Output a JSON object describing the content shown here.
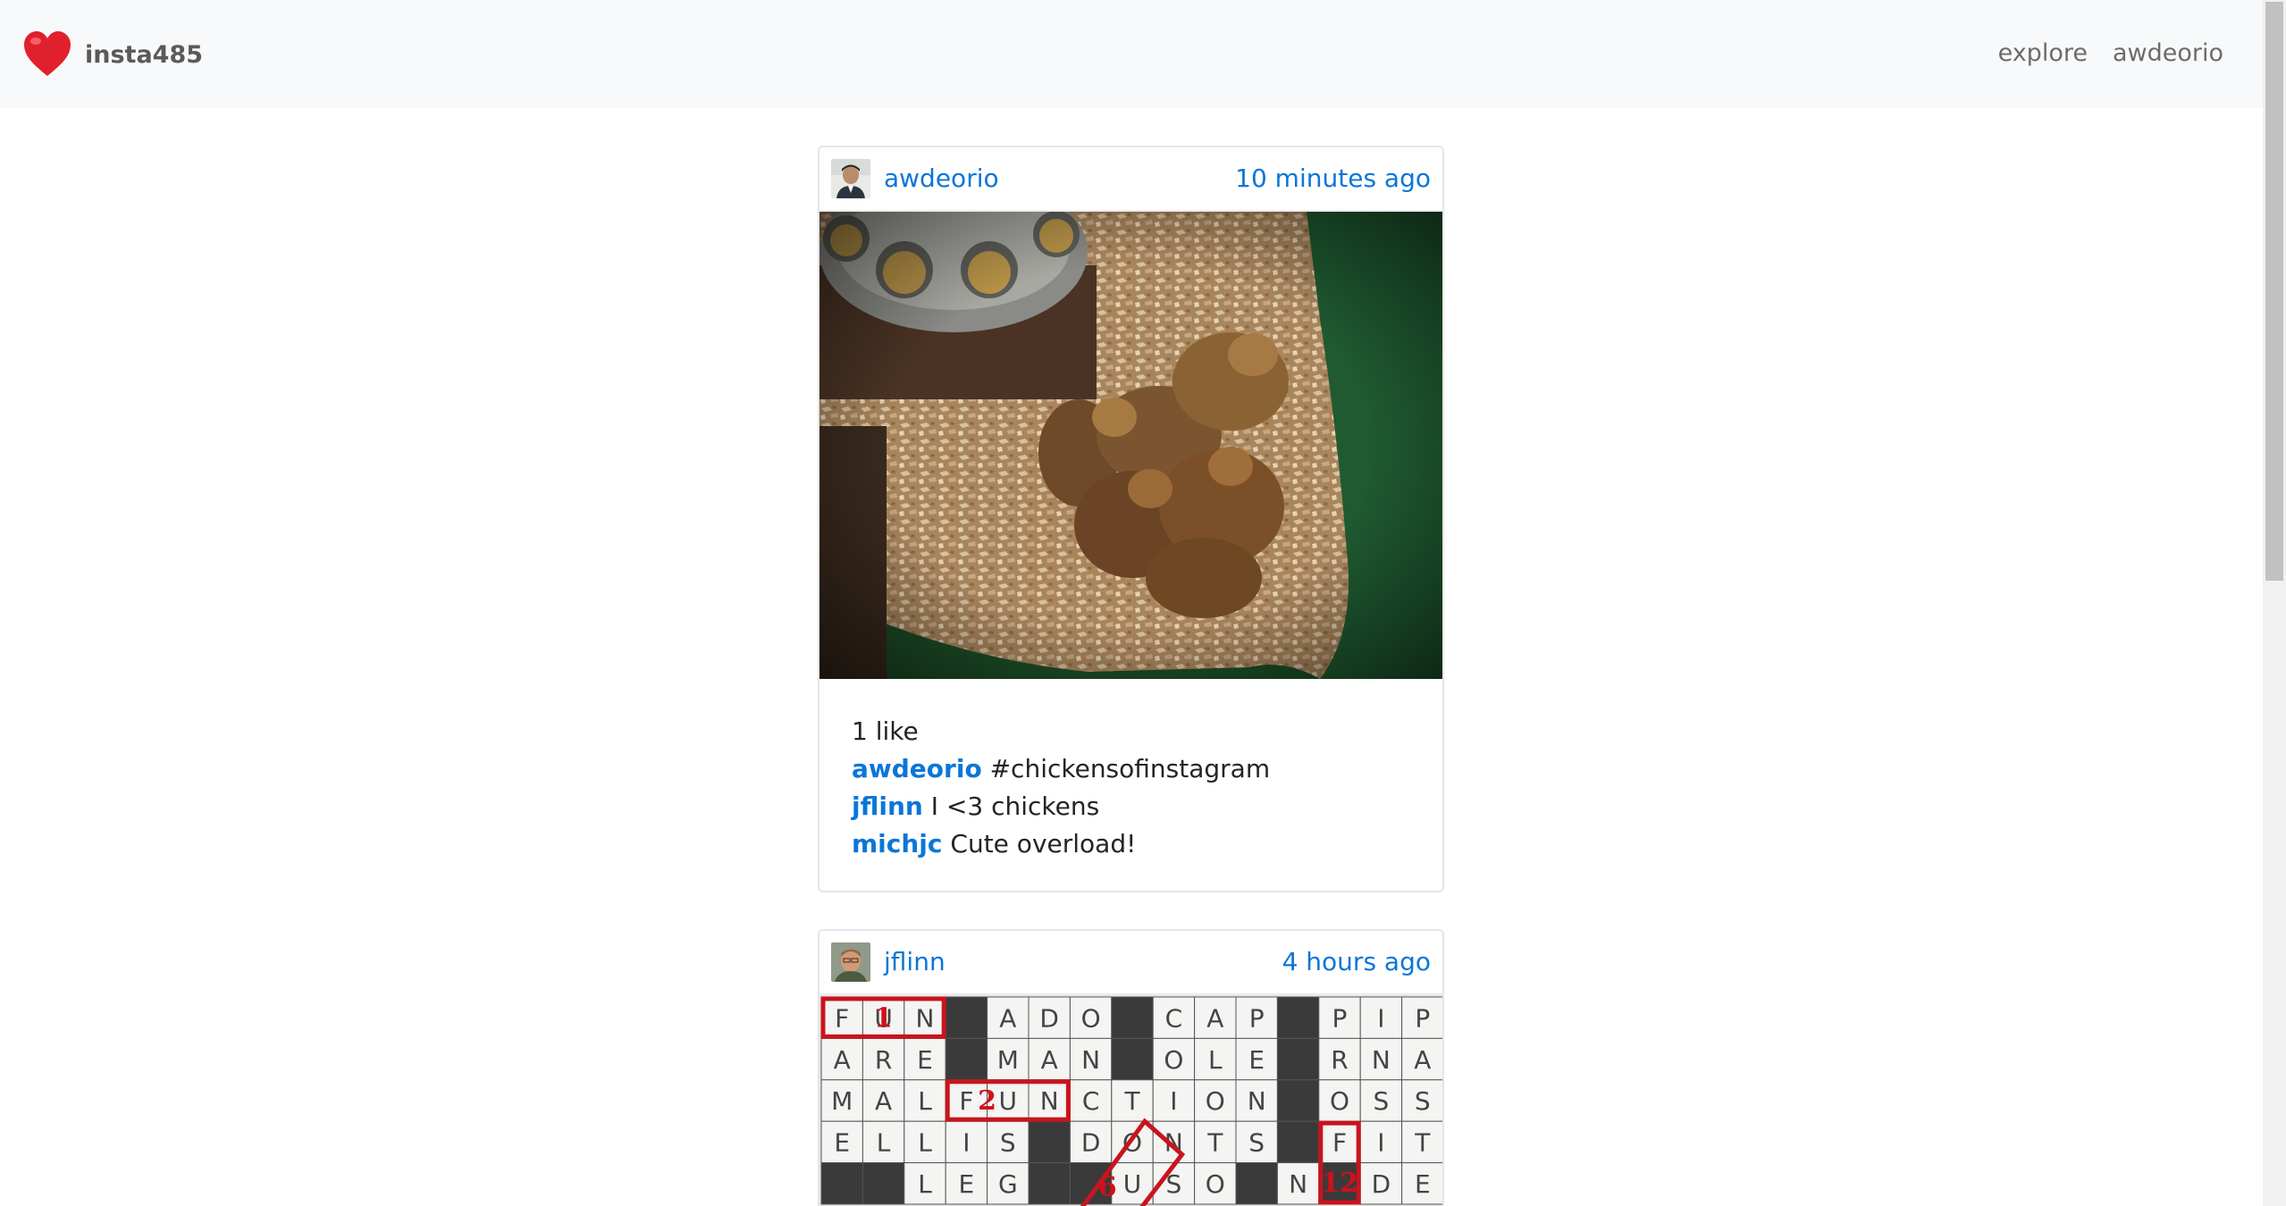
{
  "navbar": {
    "brand": "insta485",
    "links": [
      "explore",
      "awdeorio"
    ]
  },
  "posts": [
    {
      "owner": "awdeorio",
      "timestamp": "10 minutes ago",
      "likes": "1 like",
      "comments": [
        {
          "owner": "awdeorio",
          "text": "#chickensofinstagram"
        },
        {
          "owner": "jflinn",
          "text": "I <3 chickens"
        },
        {
          "owner": "michjc",
          "text": "Cute overload!"
        }
      ]
    },
    {
      "owner": "jflinn",
      "timestamp": "4 hours ago",
      "crossword": {
        "row1": [
          "F",
          "U",
          "N",
          "",
          "A",
          "D",
          "O",
          "",
          "C",
          "A",
          "P",
          "",
          "P",
          "I",
          "P"
        ],
        "row2": [
          "A",
          "R",
          "E",
          "",
          "M",
          "A",
          "N",
          "",
          "O",
          "L",
          "E",
          "",
          "R",
          "N",
          "A"
        ],
        "row3": [
          "M",
          "A",
          "L",
          "F",
          "U",
          "N",
          "C",
          "T",
          "I",
          "O",
          "N",
          "",
          "O",
          "S",
          "S"
        ],
        "row4": [
          "E",
          "L",
          "L",
          "I",
          "S",
          "",
          "D",
          "O",
          "N",
          "T",
          "S",
          "",
          "F",
          "I",
          "T"
        ],
        "row5": [
          "",
          "",
          "L",
          "E",
          "G",
          "",
          "",
          "U",
          "S",
          "O",
          "",
          "N",
          "",
          "D",
          "E"
        ],
        "markers": [
          "1",
          "2",
          "6",
          "12"
        ]
      }
    }
  ],
  "colors": {
    "link": "#0a76d8",
    "navbar_bg": "#f8f9fa",
    "heart": "#e0202c"
  }
}
